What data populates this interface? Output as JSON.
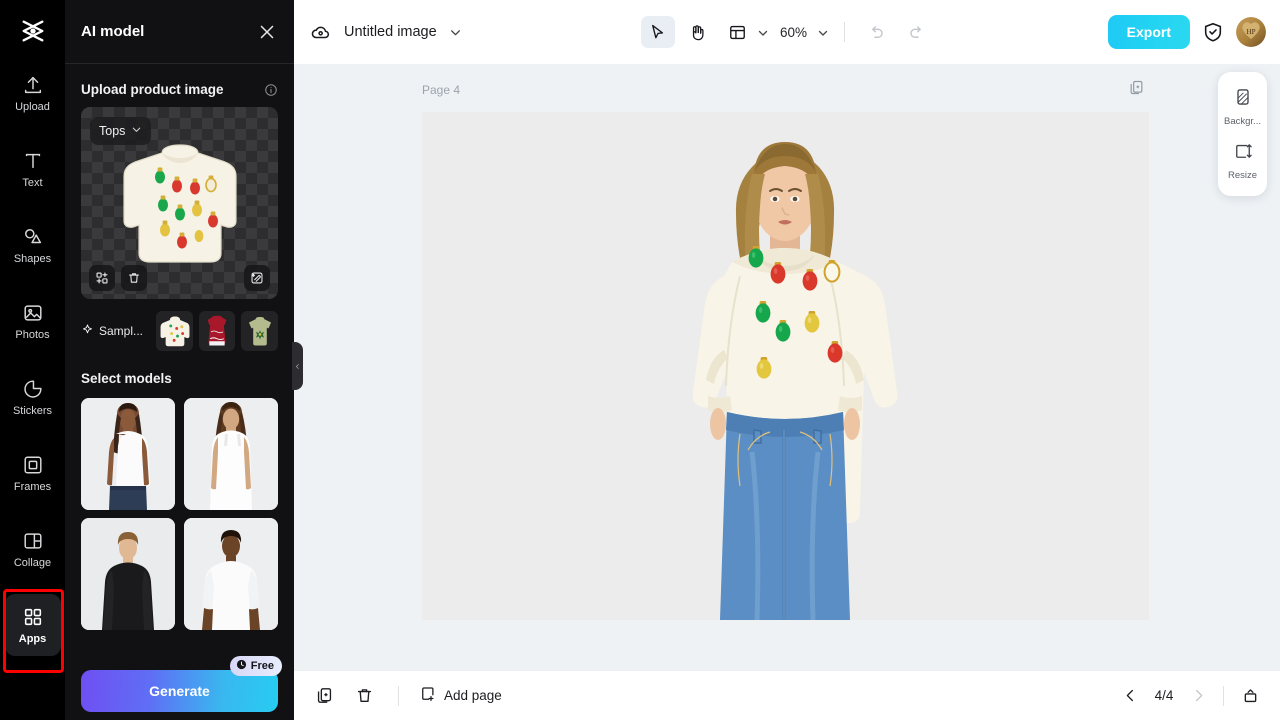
{
  "rail": {
    "logo_icon": "capcut-logo-icon",
    "items": [
      {
        "label": "Upload",
        "icon": "upload-icon",
        "selected": false
      },
      {
        "label": "Text",
        "icon": "text-icon",
        "selected": false
      },
      {
        "label": "Shapes",
        "icon": "shapes-icon",
        "selected": false
      },
      {
        "label": "Photos",
        "icon": "photos-icon",
        "selected": false
      },
      {
        "label": "Stickers",
        "icon": "stickers-icon",
        "selected": false
      },
      {
        "label": "Frames",
        "icon": "frames-icon",
        "selected": false
      },
      {
        "label": "Collage",
        "icon": "collage-icon",
        "selected": false
      },
      {
        "label": "Apps",
        "icon": "apps-grid-icon",
        "selected": true
      }
    ]
  },
  "panel": {
    "title": "AI model",
    "close_icon": "close-icon",
    "upload_section": {
      "title": "Upload product image",
      "info_icon": "info-icon",
      "category_value": "Tops",
      "category_chevron_icon": "chevron-down-icon",
      "preview_buttons": [
        {
          "name": "crop-icon"
        },
        {
          "name": "delete-icon"
        },
        {
          "name": "magic-erase-icon"
        }
      ]
    },
    "samples": {
      "label": "Sampl...",
      "sparkle_icon": "sparkle-icon",
      "thumbs": [
        "white-ornament-sweater",
        "red-christmas-dress",
        "olive-graphic-tshirt"
      ]
    },
    "models_section": {
      "title": "Select models",
      "cards": [
        {
          "name": "model-female-dark-mockneck"
        },
        {
          "name": "model-female-tank-top"
        },
        {
          "name": "model-male-black-longsleeve"
        },
        {
          "name": "model-male-white-tshirt"
        }
      ]
    },
    "generate": {
      "label": "Generate",
      "badge_label": "Free",
      "badge_icon": "clock-icon"
    },
    "collapse_icon": "chevron-left-icon"
  },
  "topbar": {
    "cloud_icon": "cloud-saved-icon",
    "doc_title": "Untitled image",
    "title_chevron_icon": "chevron-down-icon",
    "tools": [
      {
        "name": "select-tool",
        "icon": "cursor-arrow-icon",
        "active": true
      },
      {
        "name": "hand-tool",
        "icon": "hand-icon",
        "active": false
      },
      {
        "name": "layout-tool",
        "icon": "layout-panel-icon",
        "active": false
      }
    ],
    "layout_chevron_icon": "chevron-down-icon",
    "zoom_value": "60%",
    "zoom_chevron_icon": "chevron-down-icon",
    "undo_icon": "undo-icon",
    "redo_icon": "redo-icon",
    "export_label": "Export",
    "shield_icon": "shield-check-icon",
    "avatar_name": "user-avatar"
  },
  "canvas": {
    "page_label": "Page 4",
    "duplicate_page_icon": "duplicate-page-icon",
    "artwork": "female-model-christmas-ornament-sweater-blue-jeans"
  },
  "float_tools": [
    {
      "label": "Backgr...",
      "icon": "background-icon",
      "name": "background-tool"
    },
    {
      "label": "Resize",
      "icon": "resize-icon",
      "name": "resize-tool"
    }
  ],
  "bottombar": {
    "duplicate_icon": "duplicate-icon",
    "delete_icon": "trash-icon",
    "add_page_label": "Add page",
    "add_page_icon": "add-page-icon",
    "prev_icon": "chevron-left-icon",
    "next_icon": "chevron-right-icon",
    "page_indicator": "4/4",
    "pages_panel_icon": "pages-panel-icon"
  },
  "colors": {
    "accent_export": "#22d3f2",
    "generate_gradient_start": "#6f4ff2",
    "generate_gradient_end": "#27ccf2",
    "annotation_red": "#ff0000",
    "panel_bg": "#111113",
    "rail_bg": "#000000",
    "canvas_bg": "#eef2f5"
  }
}
